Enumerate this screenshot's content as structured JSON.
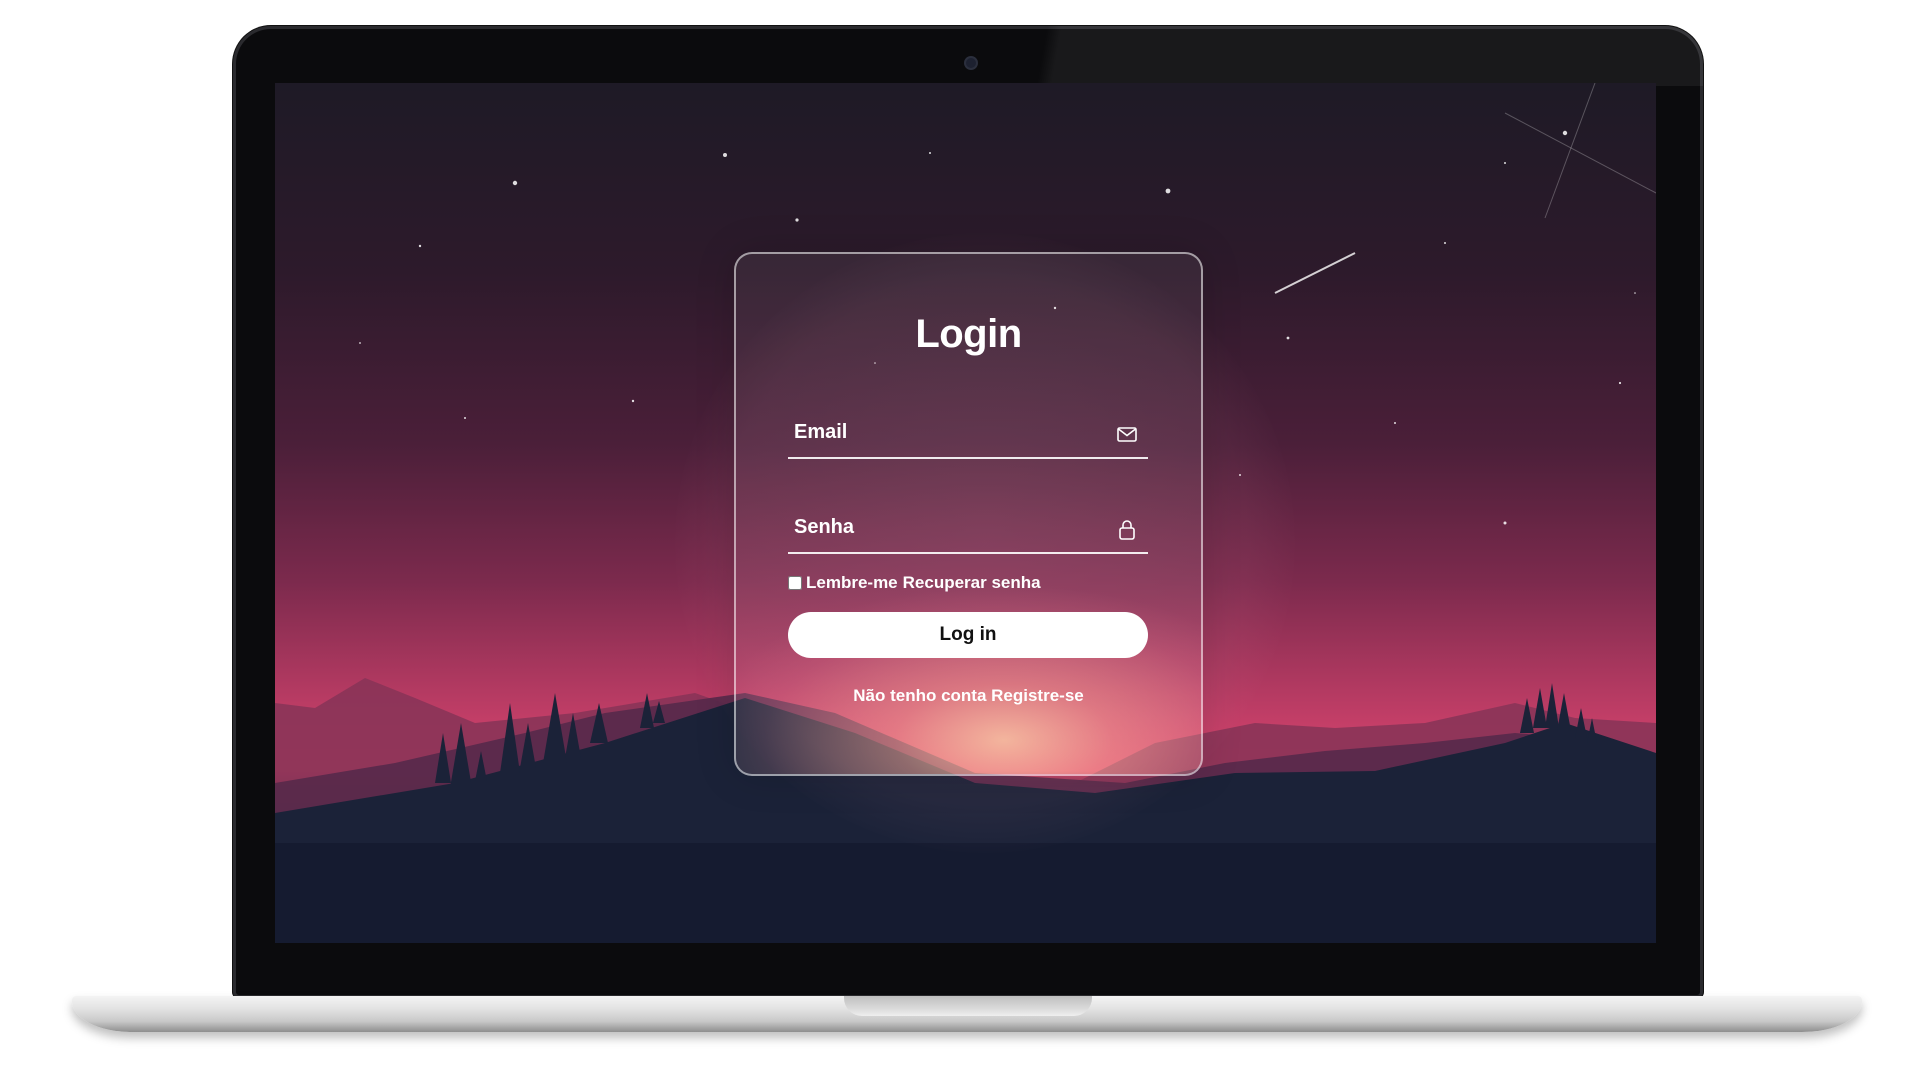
{
  "login": {
    "title": "Login",
    "email": {
      "placeholder": "Email",
      "value": "",
      "icon": "mail-icon"
    },
    "password": {
      "placeholder": "Senha",
      "value": "",
      "icon": "lock-icon"
    },
    "remember_label": "Lembre-me",
    "remember_checked": false,
    "forgot_label": "Recuperar senha",
    "submit_label": "Log in",
    "no_account_text": "Não tenho conta",
    "register_label": "Registre-se"
  },
  "colors": {
    "sky_top": "#1e1a26",
    "sky_glow": "#d8466c",
    "hills_dark": "#1b2238",
    "button_bg": "#ffffff",
    "text": "#ffffff"
  }
}
